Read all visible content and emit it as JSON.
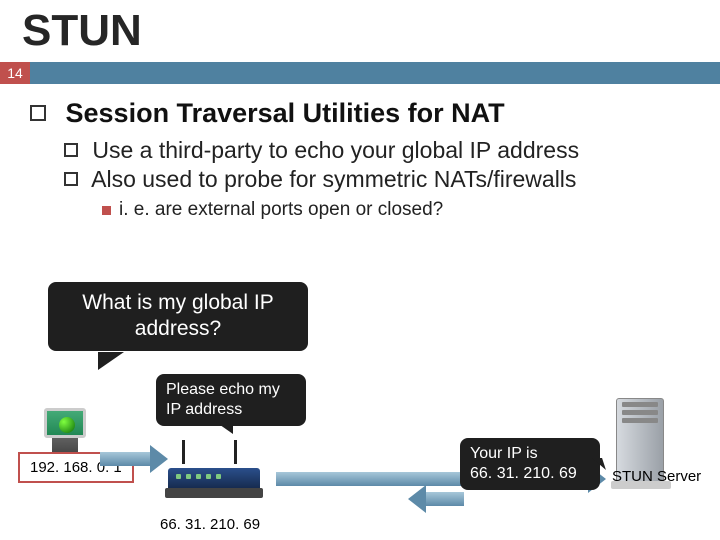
{
  "title": "STUN",
  "slide_number": "14",
  "content": {
    "h1": "Session Traversal Utilities for NAT",
    "b1_prefix": "Use",
    "b1_rest": " a third-party to echo your global IP address",
    "b2_prefix": "Also",
    "b2_rest": " used to probe for symmetric NATs/firewalls",
    "b3": "i. e. are external ports open or closed?"
  },
  "diagram": {
    "think": "What is my global IP address?",
    "ask": "Please echo my IP address",
    "answer_l1": "Your IP is",
    "answer_l2": "66. 31. 210. 69",
    "local_ip": "192. 168. 0. 1",
    "public_ip": "66. 31. 210. 69",
    "server_label": "STUN Server"
  }
}
